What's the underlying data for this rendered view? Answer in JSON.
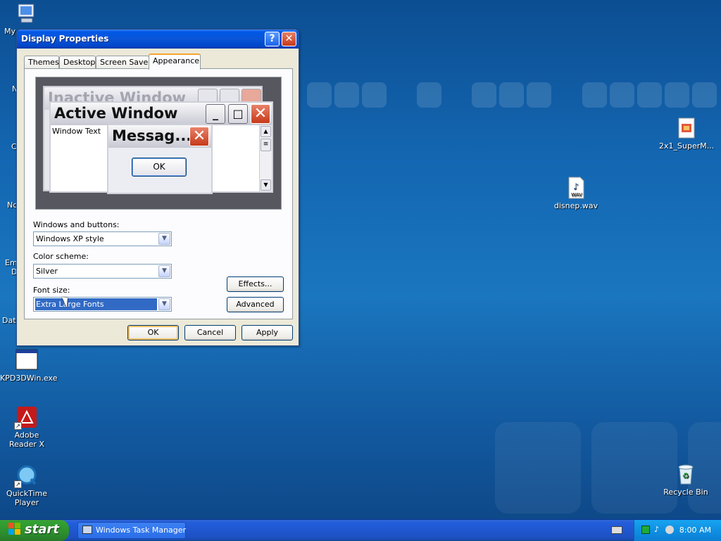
{
  "desktop": {
    "icons": [
      {
        "label": "My",
        "icon": "computer-icon"
      },
      {
        "label": "KPD3DWin.exe",
        "icon": "window-app-icon"
      },
      {
        "label": "Adobe Reader X",
        "icon": "pdf-icon"
      },
      {
        "label": "QuickTime Player",
        "icon": "quicktime-icon"
      },
      {
        "label": "2x1_SuperM...",
        "icon": "package-icon"
      },
      {
        "label": "disnep.wav",
        "icon": "audio-file-icon"
      },
      {
        "label": "Recycle Bin",
        "icon": "recycle-bin-icon"
      }
    ],
    "edge_labels": [
      "N",
      "C",
      "Nc",
      "Em",
      "D",
      "Data"
    ]
  },
  "dialog": {
    "title": "Display Properties",
    "help_label": "?",
    "close_label": "✕",
    "tabs": [
      "Themes",
      "Desktop",
      "Screen Saver",
      "Appearance"
    ],
    "active_tab": "Appearance",
    "preview": {
      "inactive_title": "Inactive Window",
      "active_title": "Active Window",
      "window_text": "Window Text",
      "message_title": "Messag...",
      "message_ok": "OK"
    },
    "windows_buttons_label": "Windows and buttons:",
    "windows_buttons_value": "Windows XP style",
    "color_scheme_label": "Color scheme:",
    "color_scheme_value": "Silver",
    "font_size_label": "Font size:",
    "font_size_value": "Extra Large Fonts",
    "effects_label": "Effects...",
    "advanced_label": "Advanced",
    "ok_label": "OK",
    "cancel_label": "Cancel",
    "apply_label": "Apply"
  },
  "taskbar": {
    "start_label": "start",
    "task_item": "Windows Task Manager",
    "clock": "8:00 AM"
  },
  "colors": {
    "xp_blue": "#0058e6",
    "start_green": "#33a133",
    "selection": "#316ac5"
  }
}
